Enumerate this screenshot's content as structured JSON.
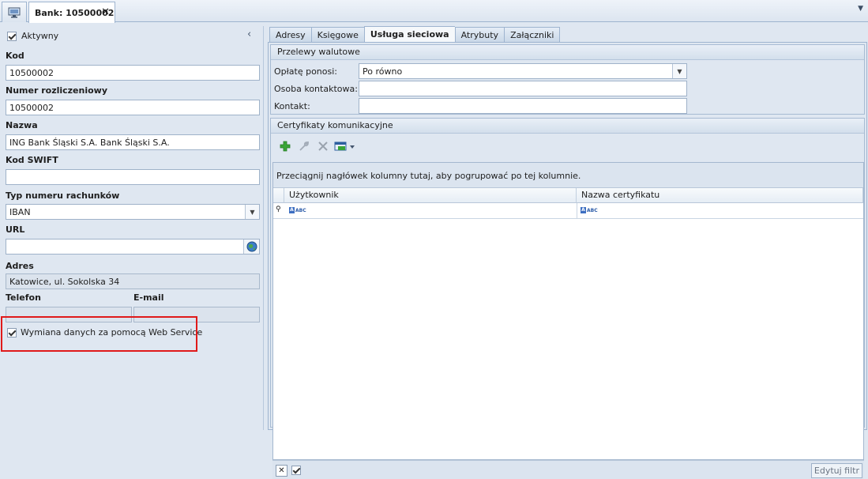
{
  "window": {
    "doc_tab_label": "Bank: 10500002",
    "close_glyph": "✕"
  },
  "left": {
    "collapse_glyph": "‹",
    "active_label": "Aktywny",
    "kod_label": "Kod",
    "kod_value": "10500002",
    "numer_label": "Numer rozliczeniowy",
    "numer_value": "10500002",
    "nazwa_label": "Nazwa",
    "nazwa_value": "ING Bank Śląski S.A.  Bank Śląski S.A.",
    "swift_label": "Kod SWIFT",
    "swift_value": "",
    "typ_label": "Typ numeru rachunków",
    "typ_value": "IBAN",
    "url_label": "URL",
    "url_value": "",
    "adres_label": "Adres",
    "adres_value": "Katowice, ul. Sokolska 34",
    "telefon_label": "Telefon",
    "telefon_value": "",
    "email_label": "E-mail",
    "email_value": "",
    "webservice_label": "Wymiana danych za pomocą Web Service"
  },
  "tabs": [
    "Adresy",
    "Księgowe",
    "Usługa sieciowa",
    "Atrybuty",
    "Załączniki"
  ],
  "active_tab": "Usługa sieciowa",
  "przelewy": {
    "title": "Przelewy walutowe",
    "oplate_label": "Opłatę ponosi:",
    "oplate_value": "Po równo",
    "osoba_label": "Osoba kontaktowa:",
    "osoba_value": "",
    "kontakt_label": "Kontakt:",
    "kontakt_value": ""
  },
  "certyfikaty": {
    "title": "Certyfikaty komunikacyjne",
    "group_hint": "Przeciągnij nagłówek kolumny tutaj, aby pogrupować po tej kolumnie.",
    "columns": [
      "Użytkownik",
      "Nazwa certyfikatu"
    ],
    "filter_glyph": "ABC",
    "edit_filter_label": "Edytuj filtr"
  },
  "icons": {
    "add": "plus-icon",
    "edit": "wrench-icon",
    "delete": "delete-icon",
    "export": "export-icon",
    "home": "monitor-icon",
    "globe": "globe-icon"
  },
  "colors": {
    "highlight": "#e01a1a",
    "accent_green": "#3aa537",
    "background": "#dfe7f1"
  }
}
